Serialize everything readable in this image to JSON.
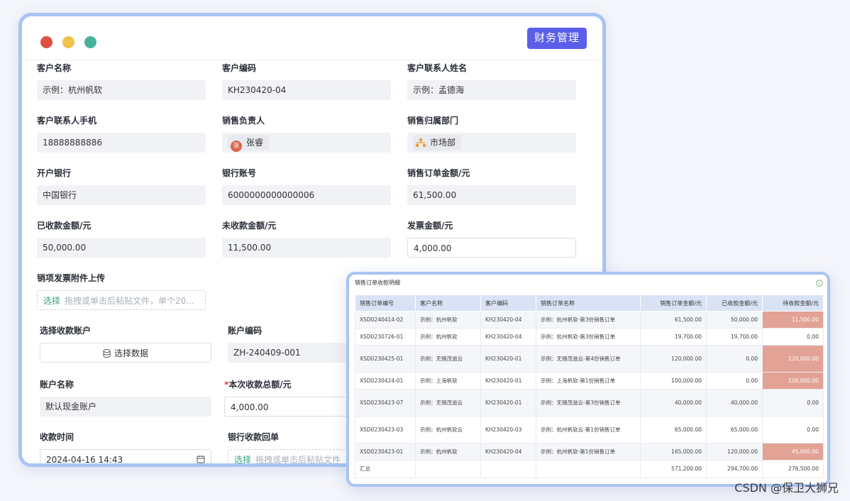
{
  "window": {
    "module_button": "财务管理"
  },
  "form": {
    "customer_name": {
      "label": "客户名称",
      "value": "示例：杭州帆软"
    },
    "customer_code": {
      "label": "客户编码",
      "value": "KH230420-04"
    },
    "contact_name": {
      "label": "客户联系人姓名",
      "value": "示例：孟德海"
    },
    "contact_phone": {
      "label": "客户联系人手机",
      "value": "18888888886"
    },
    "sales_owner": {
      "label": "销售负责人",
      "value": "张睿",
      "avatar_char": "张"
    },
    "sales_dept": {
      "label": "销售归属部门",
      "value": "市场部"
    },
    "bank": {
      "label": "开户银行",
      "value": "中国银行"
    },
    "bank_account": {
      "label": "银行账号",
      "value": "6000000000000006"
    },
    "order_amount": {
      "label": "销售订单金额/元",
      "value": "61,500.00"
    },
    "received_amount": {
      "label": "已收款金额/元",
      "value": "50,000.00"
    },
    "unreceived_amount": {
      "label": "未收款金额/元",
      "value": "11,500.00"
    },
    "invoice_amount": {
      "label": "发票金额/元",
      "value": "4,000.00"
    },
    "invoice_upload": {
      "label": "销项发票附件上传",
      "pick": "选择",
      "hint": "拖拽或单击后粘贴文件，单个20..."
    },
    "receive_account": {
      "label": "选择收款账户",
      "button": "选择数据"
    },
    "account_code": {
      "label": "账户编码",
      "value": "ZH-240409-001"
    },
    "account_name": {
      "label": "账户名称",
      "value": "默认现金账户"
    },
    "this_total": {
      "label": "本次收款总额/元",
      "required_mark": "*",
      "value": "4,000.00"
    },
    "receive_time": {
      "label": "收款时间",
      "value": "2024-04-16 14:43"
    },
    "bank_receipt": {
      "label": "银行收款回单",
      "pick": "选择",
      "hint": "拖拽或单击后粘贴文件"
    }
  },
  "table_window": {
    "title": "销售订单收款明细",
    "columns": [
      "销售订单编号",
      "客户名称",
      "客户编码",
      "销售订单名称",
      "销售订单金额/元",
      "已收款金额/元",
      "待收款金额/元"
    ],
    "rows": [
      [
        "XSD0240414-02",
        "示例：杭州帆软",
        "KH230420-04",
        "示例：杭州帆软-第3份销售订单",
        "61,500.00",
        "50,000.00",
        "11,500.00"
      ],
      [
        "XSD0230726-01",
        "示例：杭州帆软",
        "KH230420-04",
        "示例：杭州帆软-第3份销售订单",
        "19,700.00",
        "19,700.00",
        "0.00"
      ],
      [
        "XSD0230425-01",
        "示例：无锡茂滋云",
        "KH230420-01",
        "示例：无锡茂滋云-第4份销售订单",
        "120,000.00",
        "0.00",
        "120,000.00"
      ],
      [
        "XSD0230424-01",
        "示例：上海帆软",
        "KH230420-01",
        "示例：上海帆软-第1份销售订单",
        "100,000.00",
        "0.00",
        "100,000.00"
      ],
      [
        "XSD0230423-07",
        "示例：无锡茂滋云",
        "KH230420-01",
        "示例：无锡茂滋云-第3份销售订单",
        "40,000.00",
        "40,000.00",
        "0.00"
      ],
      [
        "XSD0230423-03",
        "示例：杭州帆软云",
        "KH230420-03",
        "示例：杭州帆软云-第1份销售订单",
        "65,000.00",
        "65,000.00",
        "0.00"
      ],
      [
        "XSD0230423-01",
        "示例：杭州帆软",
        "KH230420-04",
        "示例：杭州帆软-第1份销售订单",
        "165,000.00",
        "120,000.00",
        "45,000.00"
      ]
    ],
    "total": [
      "汇总",
      "",
      "",
      "",
      "571,200.00",
      "294,700.00",
      "276,500.00"
    ]
  },
  "watermark": "CSDN @保卫大狮兄",
  "colors": {
    "accent": "#5b5fe8",
    "border": "#a9c4f2",
    "pending_highlight": "#e2a295"
  }
}
